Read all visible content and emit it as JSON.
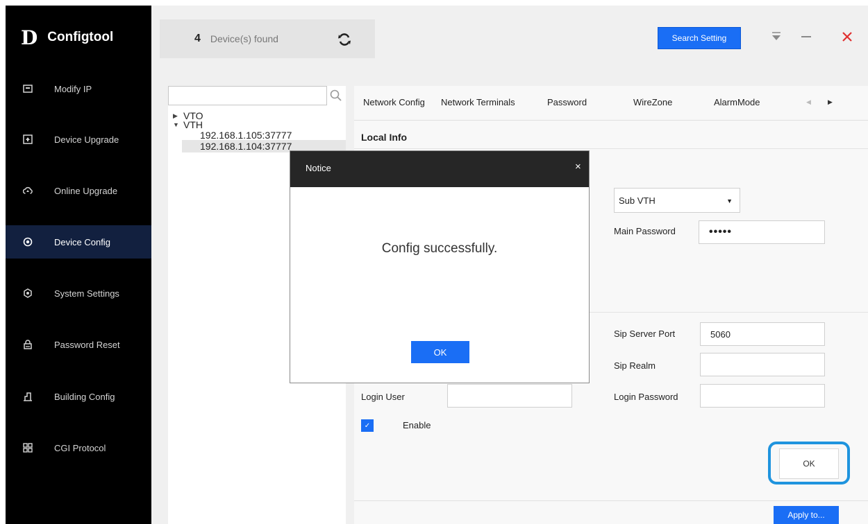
{
  "app": {
    "logo_mark": "D",
    "title": "Configtool"
  },
  "sidebar": {
    "items": [
      {
        "label": "Modify IP",
        "icon": "ip-icon"
      },
      {
        "label": "Device Upgrade",
        "icon": "upgrade-icon"
      },
      {
        "label": "Online Upgrade",
        "icon": "cloud-upgrade-icon"
      },
      {
        "label": "Device Config",
        "icon": "device-config-icon",
        "active": true
      },
      {
        "label": "System Settings",
        "icon": "gear-icon"
      },
      {
        "label": "Password Reset",
        "icon": "lock-icon"
      },
      {
        "label": "Building Config",
        "icon": "building-icon"
      },
      {
        "label": "CGI Protocol",
        "icon": "protocol-icon"
      }
    ]
  },
  "header": {
    "device_count": "4",
    "device_found_label": "Device(s) found",
    "search_setting_label": "Search Setting",
    "colors": {
      "accent": "#1a6ef5",
      "close": "#e03030"
    }
  },
  "tree": {
    "search_placeholder": "",
    "groups": [
      {
        "label": "VTO",
        "expanded": false
      },
      {
        "label": "VTH",
        "expanded": true,
        "devices": [
          "192.168.1.105:37777",
          "192.168.1.104:37777"
        ]
      }
    ]
  },
  "config": {
    "tabs": [
      "Network Config",
      "Network Terminals",
      "Password",
      "WireZone",
      "AlarmMode"
    ],
    "section_title": "Local Info",
    "device_type_value": "Sub VTH",
    "main_password_label": "Main Password",
    "main_password_value": "•••••",
    "sip_server_port_label": "Sip Server Port",
    "sip_server_port_value": "5060",
    "sip_realm_label": "Sip Realm",
    "sip_realm_value": "",
    "login_user_label": "Login User",
    "login_user_value": "",
    "login_password_label": "Login Password",
    "login_password_value": "",
    "enable_label": "Enable",
    "enable_checked": true,
    "ok_label": "OK",
    "apply_label": "Apply to..."
  },
  "modal": {
    "title": "Notice",
    "close": "×",
    "message": "Config successfully.",
    "ok_label": "OK"
  }
}
